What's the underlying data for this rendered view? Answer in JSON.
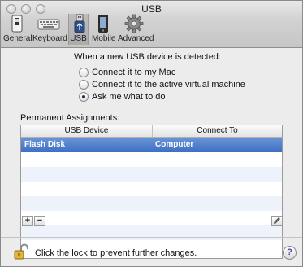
{
  "window": {
    "title": "USB"
  },
  "toolbar": {
    "items": [
      {
        "label": "General",
        "icon": "switch-icon"
      },
      {
        "label": "Keyboard",
        "icon": "keyboard-icon"
      },
      {
        "label": "USB",
        "icon": "usb-icon",
        "selected": true
      },
      {
        "label": "Mobile",
        "icon": "phone-icon"
      },
      {
        "label": "Advanced",
        "icon": "gear-icon"
      }
    ]
  },
  "usb": {
    "heading": "When a new USB device is detected:",
    "options": [
      {
        "label": "Connect it to my Mac",
        "selected": false
      },
      {
        "label": "Connect it to the active virtual machine",
        "selected": false
      },
      {
        "label": "Ask me what to do",
        "selected": true
      }
    ]
  },
  "assignments": {
    "label": "Permanent Assignments:",
    "columns": [
      "USB Device",
      "Connect To"
    ],
    "rows": [
      {
        "device": "Flash Disk",
        "target": "Computer",
        "selected": true
      }
    ],
    "add_label": "+",
    "remove_label": "−"
  },
  "footer": {
    "lock_text": "Click the lock to prevent further changes.",
    "help_label": "?"
  },
  "colors": {
    "selection": "#3d6fc4",
    "window_bg": "#ececec"
  }
}
